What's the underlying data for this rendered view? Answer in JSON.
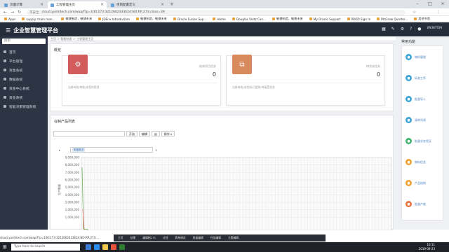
{
  "browser": {
    "tabs": [
      {
        "title": "页面计算"
      },
      {
        "title": "工程管理主页"
      },
      {
        "title": "项目配置定义"
      }
    ],
    "address": {
      "not_secure": "不安全",
      "url": "cloud.yunhitech.com/wap/f?p=100:273:3212662333624:NO:RP,273:class=39"
    },
    "bookmarks": [
      "Apps",
      "supply chain man...",
      "敏捷制造，敏捷未来",
      "JDEnv Introduction",
      "敏捷制造，敏捷未来",
      "Oracle Fusion Sup...",
      "Home",
      "Douglas Viotz Con...",
      "敏捷制造，敏捷未来",
      "My Oracle Support",
      "PROD Sign In",
      "McGraw Quarter...",
      "其他书签"
    ]
  },
  "app": {
    "title": "企业智慧管理平台",
    "user": "WENITEM"
  },
  "sidebar": {
    "search_placeholder": "搜索",
    "items": [
      "首页",
      "平台管理",
      "资金系统",
      "数据系统",
      "资金中心系统",
      "资金系统",
      "智能决策管理系统"
    ]
  },
  "breadcrumb": "主页 ＞ 智能制造 ＞ 工程管理主页",
  "overview": {
    "title": "概览",
    "cards": [
      {
        "label": "结束项目任务",
        "value": "0",
        "footer": "当前有效/审批/未签约项目",
        "color": "#d25b5b"
      },
      {
        "label": "待完成任务",
        "value": "0",
        "footer": "当前有效/未完成/已超时/待接受任务",
        "color": "#d98a5c"
      }
    ]
  },
  "list": {
    "title": "在制产品列表",
    "buttons": [
      "开始",
      "编辑",
      "",
      "操作"
    ],
    "filter_chip": "制造批次",
    "y_label": "生产数量",
    "chart_y_ticks": [
      "9,000,000",
      "8,000,000",
      "7,000,000",
      "6,000,000",
      "5,000,000",
      "4,000,000",
      "3,000,000",
      "2,000,000",
      "1,000,000"
    ]
  },
  "chart_data": {
    "type": "line",
    "y_ticks": [
      9000000,
      8000000,
      7000000,
      6000000,
      5000000,
      4000000,
      3000000,
      2000000,
      1000000
    ],
    "ylabel": "生产数量",
    "grid": true
  },
  "right": {
    "title": "常用功能",
    "items": [
      {
        "label": "物料管理",
        "color": "#3ba4d8"
      },
      {
        "label": "标准工序",
        "color": "#3ba4d8"
      },
      {
        "label": "批量导入",
        "color": "#3ba4d8"
      },
      {
        "label": "清单列表",
        "color": "#3ba4d8"
      },
      {
        "label": "批量业务凭证",
        "color": "#3cb371"
      },
      {
        "label": "物料信息",
        "color": "#f0a030"
      },
      {
        "label": "产品结构",
        "color": "#f0a030"
      },
      {
        "label": "批量产能",
        "color": "#e8733c"
      }
    ]
  },
  "floatbar": [
    "主页",
    "处理",
    "编辑制273",
    "计划",
    "表单调试",
    "批量编辑",
    "任务编辑",
    "主题编辑"
  ],
  "status_url": "cloud.yunhitech.com/wap/f?p=100:273:3212662333624:NO:RP,273:...",
  "taskbar": {
    "search_placeholder": "Type here to search",
    "time": "10:11",
    "date": "2019-09-23"
  }
}
